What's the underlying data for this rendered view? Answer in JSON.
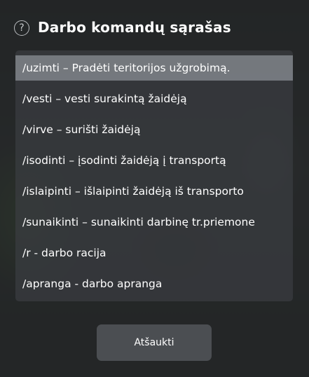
{
  "dialog": {
    "title": "Darbo komandų sąrašas",
    "help_icon": "?"
  },
  "commands": [
    {
      "label": "/uzimti – Pradėti teritorijos užgrobimą.",
      "selected": true
    },
    {
      "label": "/vesti – vesti surakintą žaidėją",
      "selected": false
    },
    {
      "label": "/virve – surišti žaidėją",
      "selected": false
    },
    {
      "label": "/isodinti – įsodinti žaidėją į transportą",
      "selected": false
    },
    {
      "label": "/islaipinti – išlaipinti žaidėją iš transporto",
      "selected": false
    },
    {
      "label": "/sunaikinti – sunaikinti darbinę tr.priemone",
      "selected": false
    },
    {
      "label": "/r - darbo racija",
      "selected": false
    },
    {
      "label": "/apranga - darbo apranga",
      "selected": false
    }
  ],
  "footer": {
    "cancel_label": "Atšaukti"
  }
}
